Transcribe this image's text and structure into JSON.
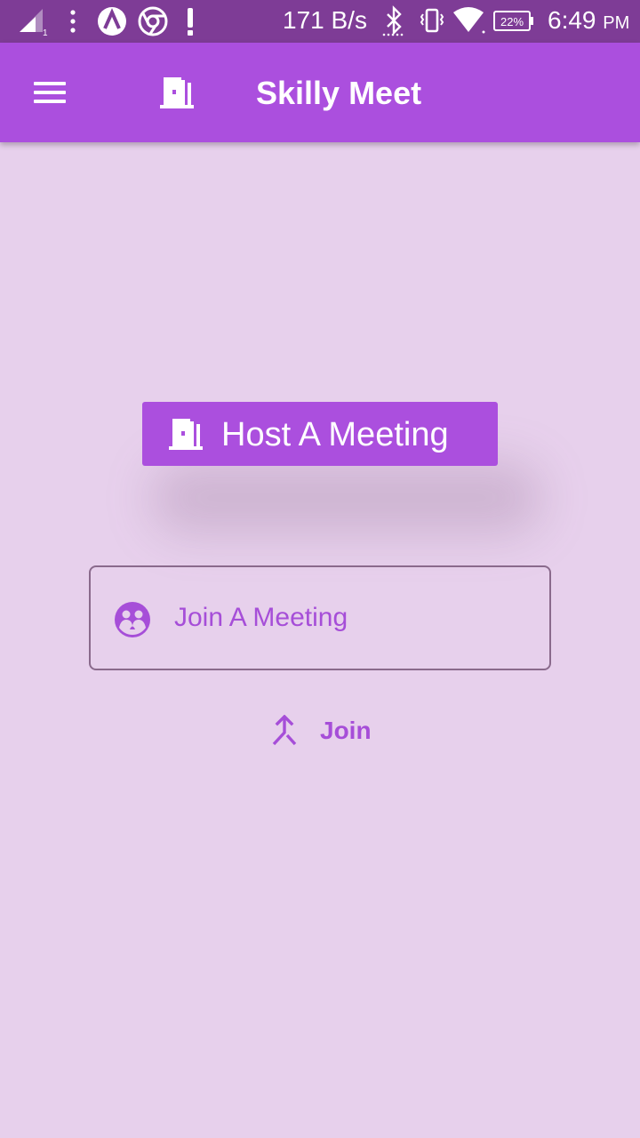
{
  "status_bar": {
    "network_speed": "171 B/s",
    "battery_percent": "22%",
    "time": "6:49",
    "ampm": "PM",
    "icons": [
      "signal-icon",
      "more-vert-icon",
      "app-a-icon",
      "chrome-icon",
      "alert-icon",
      "bluetooth-icon",
      "vibrate-icon",
      "wifi-icon",
      "battery-icon"
    ]
  },
  "app_bar": {
    "title": "Skilly Meet",
    "menu_icon": "menu-icon",
    "logo_icon": "door-icon"
  },
  "main": {
    "host_button": {
      "label": "Host A Meeting",
      "icon": "door-icon"
    },
    "join_field": {
      "placeholder": "Join A Meeting",
      "value": "",
      "icon": "group-icon"
    },
    "join_button": {
      "label": "Join",
      "icon": "merge-icon"
    }
  },
  "colors": {
    "status_bar": "#7e3c96",
    "app_bar": "#ab4fde",
    "background": "#e7d0ec",
    "accent": "#a64ed8"
  }
}
